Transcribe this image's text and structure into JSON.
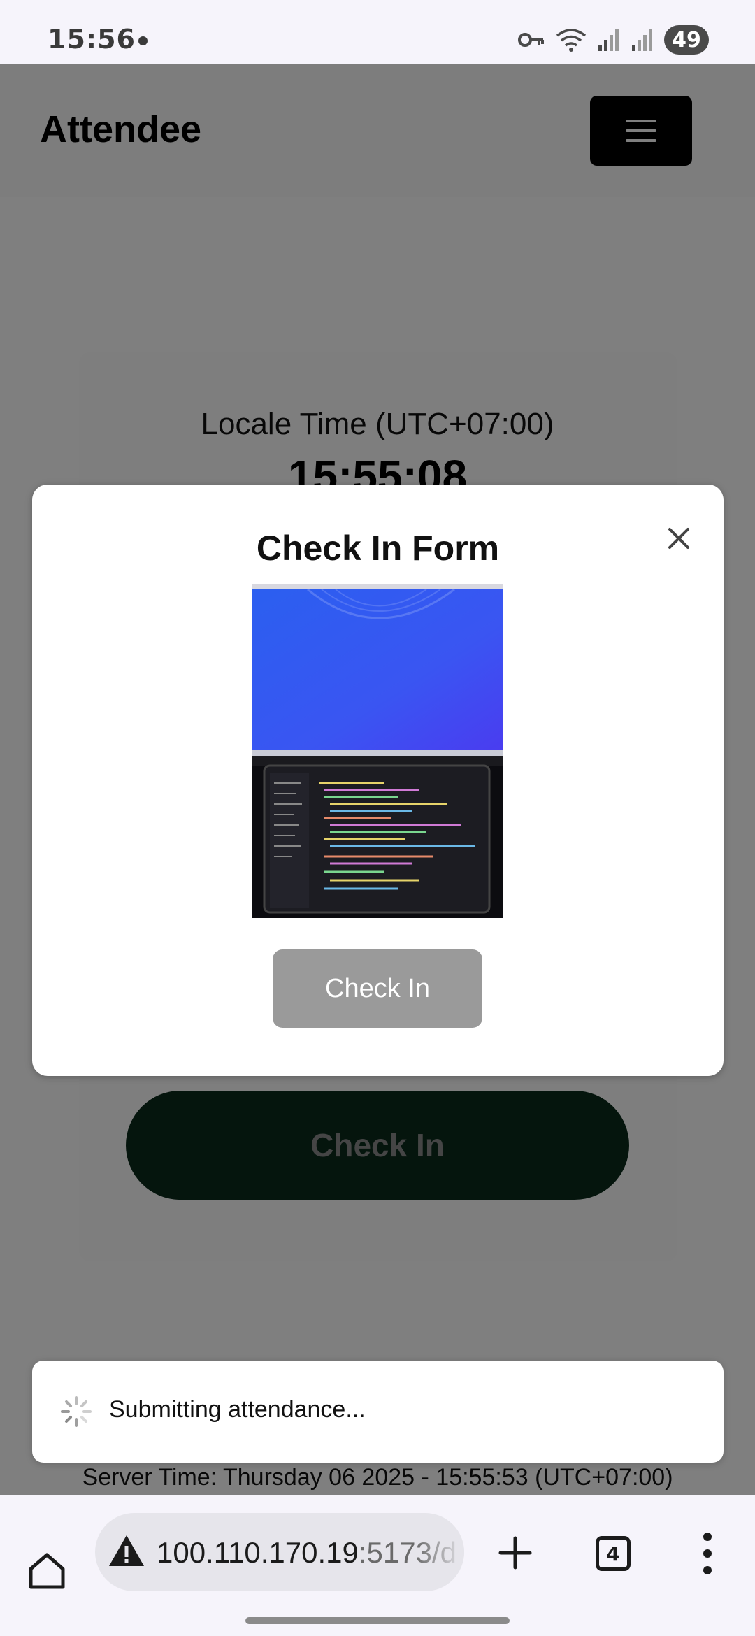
{
  "status_bar": {
    "time": "15:56",
    "battery": "49",
    "icons": [
      "vpn-key-icon",
      "wifi-icon",
      "signal-icon",
      "signal-icon"
    ]
  },
  "header": {
    "brand": "Attendee",
    "menu_icon": "hamburger-icon"
  },
  "main": {
    "locale_label": "Locale Time (UTC+07:00)",
    "locale_time": "15:55:08",
    "check_in_label": "Check In",
    "server_time": "Server Time: Thursday 06 2025 - 15:55:53 (UTC+07:00)"
  },
  "modal": {
    "title": "Check In Form",
    "close_icon": "close-icon",
    "submit_label": "Check In"
  },
  "toast": {
    "message": "Submitting attendance...",
    "icon": "spinner-icon"
  },
  "browser": {
    "url_host": "100.110.170.19",
    "url_rest": ":5173/d",
    "tabs_count": "4",
    "icons": [
      "home-icon",
      "warning-icon",
      "new-tab-plus-icon",
      "tabs-icon",
      "more-vert-icon"
    ]
  },
  "colors": {
    "primary_dark_green": "#0a2a1a",
    "overlay": "rgba(0,0,0,0.5)",
    "disabled_button": "#9a9a9a"
  }
}
